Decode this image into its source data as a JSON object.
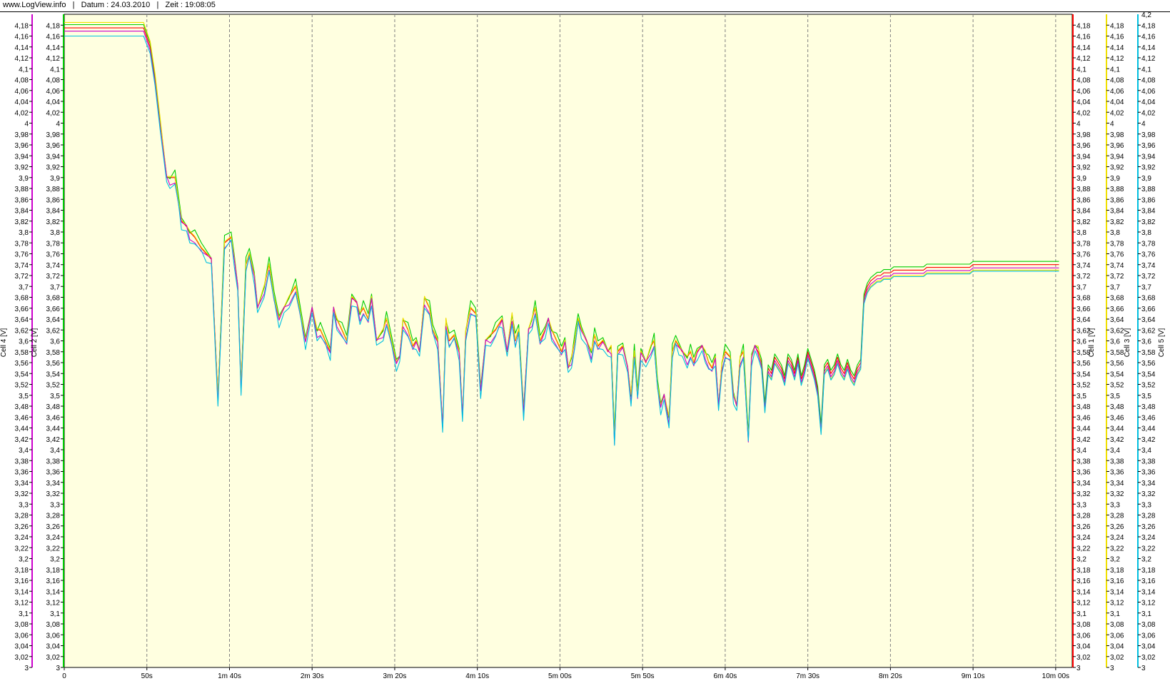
{
  "header": {
    "site": "www.LogView.info",
    "date": "Datum : 24.03.2010",
    "time": "Zeit : 19:08:05"
  },
  "chart_data": {
    "type": "line",
    "title": "",
    "background": "#ffffe0",
    "grid": "vertical-dashed",
    "xlabel": "",
    "xlim_seconds": [
      0,
      610
    ],
    "x_ticks": [
      "0",
      "50s",
      "1m 40s",
      "2m 30s",
      "3m 20s",
      "4m 10s",
      "5m 00s",
      "5m 50s",
      "6m 40s",
      "7m 30s",
      "8m 20s",
      "9m 10s",
      "10m 00s"
    ],
    "y_ticks": [
      "3",
      "3,02",
      "3,04",
      "3,06",
      "3,08",
      "3,1",
      "3,12",
      "3,14",
      "3,16",
      "3,18",
      "3,2",
      "3,22",
      "3,24",
      "3,26",
      "3,28",
      "3,3",
      "3,32",
      "3,34",
      "3,36",
      "3,38",
      "3,4",
      "3,42",
      "3,44",
      "3,46",
      "3,48",
      "3,5",
      "3,52",
      "3,54",
      "3,56",
      "3,58",
      "3,6",
      "3,62",
      "3,64",
      "3,66",
      "3,68",
      "3,7",
      "3,72",
      "3,74",
      "3,76",
      "3,78",
      "3,8",
      "3,82",
      "3,84",
      "3,86",
      "3,88",
      "3,9",
      "3,92",
      "3,94",
      "3,96",
      "3,98",
      "4",
      "4,02",
      "4,04",
      "4,06",
      "4,08",
      "4,1",
      "4,12",
      "4,14",
      "4,16",
      "4,18"
    ],
    "y_extra_tick": "4,2",
    "ylim": [
      3,
      4.2
    ],
    "axes": [
      {
        "label": "Cell 4 [V]",
        "side": "left",
        "color": "#cc00cc"
      },
      {
        "label": "Cell 2 [V]",
        "side": "left",
        "color": "#00cc00"
      },
      {
        "label": "Cell 1 [V]",
        "side": "right",
        "color": "#ff0000"
      },
      {
        "label": "Cell 3 [V]",
        "side": "right",
        "color": "#f0e000"
      },
      {
        "label": "Cell 5 [V]",
        "side": "right",
        "color": "#00c0e0"
      }
    ],
    "x": [
      0,
      10,
      20,
      30,
      40,
      48,
      52,
      55,
      58,
      62,
      64,
      67,
      69,
      71,
      74,
      76,
      79,
      83,
      86,
      89,
      93,
      97,
      101,
      103,
      105,
      107,
      110,
      112,
      115,
      117,
      121,
      124,
      127,
      130,
      133,
      136,
      140,
      143,
      146,
      150,
      153,
      155,
      158,
      161,
      163,
      165,
      168,
      171,
      174,
      177,
      179,
      181,
      184,
      186,
      189,
      193,
      195,
      198,
      201,
      203,
      205,
      208,
      211,
      213,
      215,
      218,
      221,
      223,
      226,
      229,
      231,
      233,
      236,
      239,
      241,
      243,
      246,
      249,
      252,
      255,
      258,
      261,
      263,
      265,
      268,
      271,
      273,
      275,
      278,
      281,
      283,
      285,
      288,
      291,
      293,
      295,
      298,
      301,
      303,
      305,
      307,
      309,
      311,
      313,
      316,
      319,
      321,
      323,
      326,
      329,
      331,
      333,
      335,
      338,
      341,
      343,
      345,
      347,
      349,
      352,
      355,
      357,
      359,
      361,
      363,
      366,
      368,
      370,
      372,
      374,
      377,
      379,
      381,
      383,
      386,
      388,
      390,
      392,
      394,
      396,
      398,
      400,
      403,
      405,
      407,
      409,
      411,
      414,
      416,
      418,
      420,
      422,
      424,
      426,
      428,
      430,
      432,
      434,
      436,
      438,
      440,
      442,
      444,
      446,
      448,
      450,
      452,
      454,
      456,
      458,
      460,
      462,
      464,
      466,
      468,
      470,
      472,
      474,
      476,
      478,
      480,
      482,
      484,
      486,
      488,
      490,
      492,
      494,
      496,
      498,
      500,
      502,
      504,
      506,
      508,
      510,
      512,
      514,
      516,
      518,
      520,
      522,
      524,
      526,
      528,
      530,
      532,
      534,
      536,
      538,
      540,
      542,
      544,
      546,
      548,
      550,
      552,
      554,
      556,
      558,
      560,
      562,
      564,
      566,
      568,
      570,
      572,
      574,
      576,
      578,
      580,
      582,
      584,
      586,
      588,
      590,
      592,
      594,
      596,
      598,
      600,
      602,
      604,
      606,
      608,
      610
    ],
    "series": [
      {
        "name": "Cell 1",
        "color": "#ff0000",
        "offset": 0.0,
        "values": [
          4.175,
          4.175,
          4.175,
          4.175,
          4.175,
          4.175,
          4.14,
          4.08,
          4,
          3.9,
          3.9,
          3.9,
          3.86,
          3.82,
          3.81,
          3.8,
          3.79,
          3.77,
          3.76,
          3.75,
          3.5,
          3.78,
          3.79,
          3.75,
          3.7,
          3.52,
          3.74,
          3.76,
          3.72,
          3.66,
          3.7,
          3.74,
          3.68,
          3.64,
          3.66,
          3.68,
          3.7,
          3.65,
          3.6,
          3.66,
          3.62,
          3.62,
          3.6,
          3.58,
          3.66,
          3.64,
          3.62,
          3.6,
          3.68,
          3.67,
          3.65,
          3.66,
          3.64,
          3.68,
          3.6,
          3.62,
          3.64,
          3.6,
          3.56,
          3.57,
          3.64,
          3.62,
          3.59,
          3.6,
          3.58,
          3.68,
          3.66,
          3.62,
          3.6,
          3.44,
          3.64,
          3.6,
          3.61,
          3.58,
          3.46,
          3.62,
          3.66,
          3.65,
          3.51,
          3.6,
          3.61,
          3.62,
          3.63,
          3.64,
          3.58,
          3.65,
          3.6,
          3.62,
          3.47,
          3.62,
          3.64,
          3.66,
          3.6,
          3.62,
          3.64,
          3.62,
          3.6,
          3.58,
          3.6,
          3.55,
          3.57,
          3.6,
          3.64,
          3.62,
          3.6,
          3.58,
          3.61,
          3.59,
          3.6,
          3.58,
          3.59,
          3.42,
          3.58,
          3.59,
          3.55,
          3.5,
          3.58,
          3.5,
          3.58,
          3.56,
          3.59,
          3.6,
          3.52,
          3.48,
          3.5,
          3.46,
          3.58,
          3.6,
          3.59,
          3.58,
          3.57,
          3.58,
          3.56,
          3.58,
          3.59,
          3.58,
          3.56,
          3.55,
          3.57,
          3.48,
          3.56,
          3.58,
          3.57,
          3.5,
          3.48,
          3.57,
          3.58,
          3.42,
          3.57,
          3.59,
          3.58,
          3.56,
          3.48,
          3.55,
          3.54,
          3.57,
          3.56,
          3.55,
          3.53,
          3.57,
          3.56,
          3.54,
          3.57,
          3.53,
          3.55,
          3.58,
          3.56,
          3.54,
          3.51,
          3.44,
          3.55,
          3.56,
          3.54,
          3.55,
          3.57,
          3.55,
          3.54,
          3.56,
          3.54,
          3.53,
          3.55,
          3.56,
          3.68,
          3.7,
          3.71,
          3.715,
          3.72,
          3.72,
          3.725,
          3.725,
          3.725,
          3.73,
          3.73,
          3.73,
          3.73,
          3.73,
          3.73,
          3.73,
          3.73,
          3.73,
          3.73,
          3.735,
          3.735,
          3.735,
          3.735,
          3.735,
          3.735,
          3.735,
          3.735,
          3.735,
          3.735,
          3.735,
          3.735,
          3.735,
          3.735,
          3.74,
          3.74,
          3.74,
          3.74,
          3.74,
          3.74,
          3.74,
          3.74,
          3.74,
          3.74,
          3.74,
          3.74,
          3.74,
          3.74,
          3.74,
          3.74,
          3.74,
          3.74,
          3.74,
          3.74,
          3.74,
          3.74,
          3.74,
          3.74,
          3.74,
          3.74,
          3.74
        ]
      },
      {
        "name": "Cell 2",
        "color": "#00cc00",
        "offset": 0.006
      },
      {
        "name": "Cell 3",
        "color": "#f0e000",
        "offset": 0.01
      },
      {
        "name": "Cell 4",
        "color": "#cc00cc",
        "offset": -0.006
      },
      {
        "name": "Cell 5",
        "color": "#00c0e0",
        "offset": -0.012
      }
    ]
  }
}
